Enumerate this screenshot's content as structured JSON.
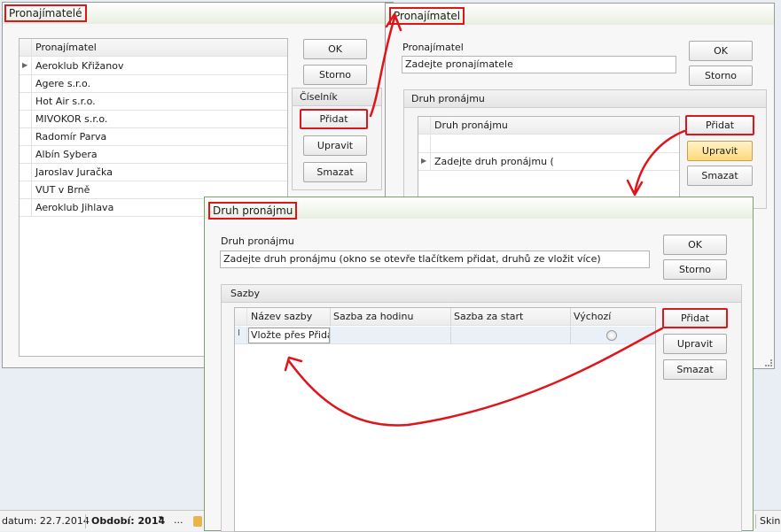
{
  "window1": {
    "title": "Pronajímatelé",
    "grid_header": "Pronajímatel",
    "rows": [
      "Aeroklub Křižanov",
      "Agere s.r.o.",
      "Hot Air s.r.o.",
      "MIVOKOR s.r.o.",
      "Radomír Parva",
      "Albín Sybera",
      "Jaroslav Juračka",
      "VUT v Brně",
      "Aeroklub Jihlava"
    ],
    "ok": "OK",
    "storno": "Storno",
    "group_title": "Číselník",
    "pridat": "Přidat",
    "upravit": "Upravit",
    "smazat": "Smazat"
  },
  "window2": {
    "title": "Pronajímatel",
    "field_label": "Pronajímatel",
    "field_value": "Zadejte pronajímatele",
    "ok": "OK",
    "storno": "Storno",
    "group_title": "Druh pronájmu",
    "grid_header": "Druh pronájmu",
    "row": "Zadejte druh pronájmu (",
    "pridat": "Přidat",
    "upravit": "Upravit",
    "smazat": "Smazat"
  },
  "window3": {
    "title": "Druh pronájmu",
    "field_label": "Druh pronájmu",
    "field_value": "Zadejte druh pronájmu (okno se otevře tlačítkem přidat, druhů ze vložit více)",
    "ok": "OK",
    "storno": "Storno",
    "group_title": "Sazby",
    "columns": [
      "Název sazby",
      "Sazba za hodinu",
      "Sazba za start",
      "Výchozí"
    ],
    "row_value": "Vložte přes Přidat",
    "pridat": "Přidat",
    "upravit": "Upravit",
    "smazat": "Smazat"
  },
  "statusbar": {
    "datum": "datum: 22.7.2014",
    "obdobi": "Období: 2014",
    "dots": "...",
    "skin": "Skin"
  },
  "colors": {
    "highlight": "#e0151c",
    "arrow": "#e0151c"
  }
}
